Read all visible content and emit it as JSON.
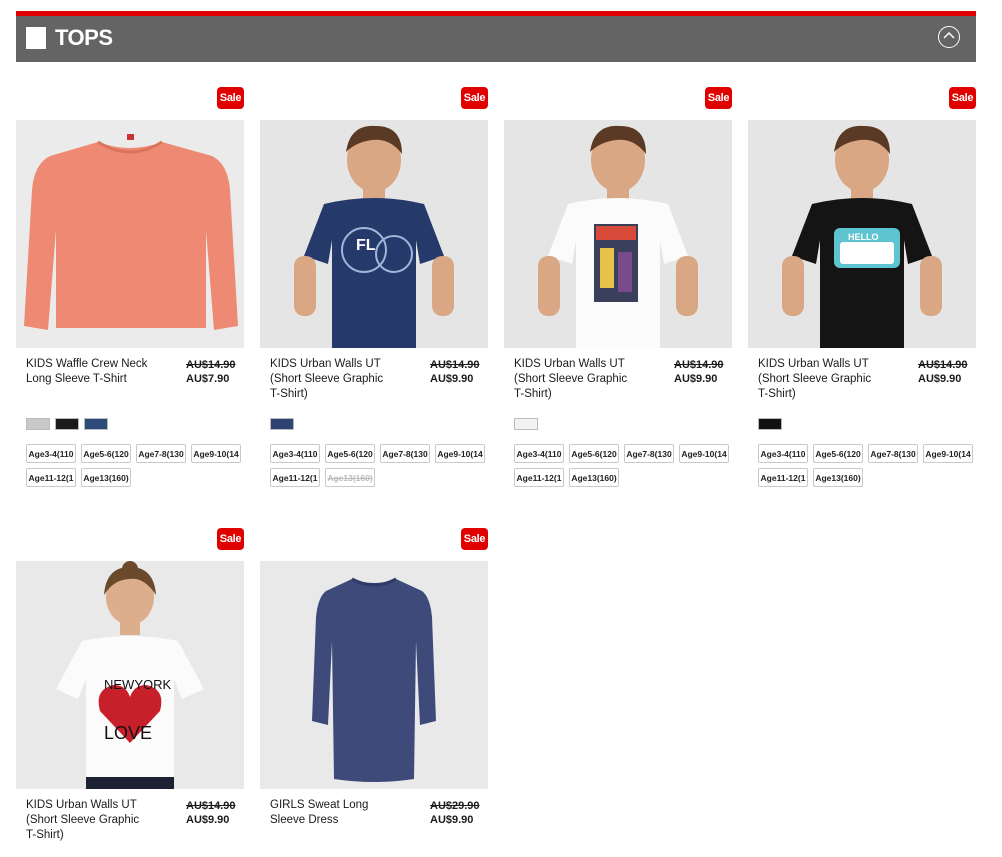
{
  "section": {
    "title": "TOPS"
  },
  "colors": {
    "accent": "#e00000",
    "header_bg": "#646464"
  },
  "products": [
    {
      "sale_label": "Sale",
      "name": "KIDS Waffle Crew Neck Long Sleeve T-Shirt",
      "was_price": "AU$14.90",
      "price": "AU$7.90",
      "swatches": [
        "#c9c9c9",
        "#1a1a1a",
        "#2c4a7a"
      ],
      "sizes": [
        "Age3-4(110",
        "Age5-6(120",
        "Age7-8(130",
        "Age9-10(14",
        "Age11-12(1",
        "Age13(160)"
      ],
      "unavailable_sizes": []
    },
    {
      "sale_label": "Sale",
      "name": "KIDS Urban Walls UT (Short Sleeve Graphic T-Shirt)",
      "was_price": "AU$14.90",
      "price": "AU$9.90",
      "swatches": [
        "#2c4373"
      ],
      "sizes": [
        "Age3-4(110",
        "Age5-6(120",
        "Age7-8(130",
        "Age9-10(14",
        "Age11-12(1",
        "Age13(160)"
      ],
      "unavailable_sizes": [
        "Age13(160)"
      ]
    },
    {
      "sale_label": "Sale",
      "name": "KIDS Urban Walls UT (Short Sleeve Graphic T-Shirt)",
      "was_price": "AU$14.90",
      "price": "AU$9.90",
      "swatches": [
        "#f2f2f2"
      ],
      "sizes": [
        "Age3-4(110",
        "Age5-6(120",
        "Age7-8(130",
        "Age9-10(14",
        "Age11-12(1",
        "Age13(160)"
      ],
      "unavailable_sizes": []
    },
    {
      "sale_label": "Sale",
      "name": "KIDS Urban Walls UT (Short Sleeve Graphic T-Shirt)",
      "was_price": "AU$14.90",
      "price": "AU$9.90",
      "swatches": [
        "#111111"
      ],
      "sizes": [
        "Age3-4(110",
        "Age5-6(120",
        "Age7-8(130",
        "Age9-10(14",
        "Age11-12(1",
        "Age13(160)"
      ],
      "unavailable_sizes": []
    },
    {
      "sale_label": "Sale",
      "name": "KIDS Urban Walls UT (Short Sleeve Graphic T-Shirt)",
      "was_price": "AU$14.90",
      "price": "AU$9.90",
      "swatches": [],
      "sizes": [],
      "unavailable_sizes": []
    },
    {
      "sale_label": "Sale",
      "name": "GIRLS Sweat Long Sleeve Dress",
      "was_price": "AU$29.90",
      "price": "AU$9.90",
      "swatches": [],
      "sizes": [],
      "unavailable_sizes": []
    }
  ]
}
